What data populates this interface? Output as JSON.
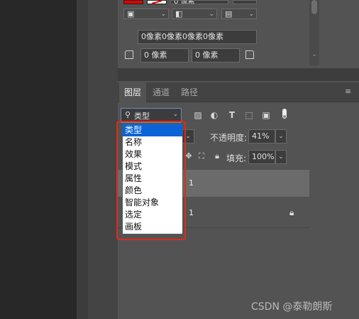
{
  "app": {
    "colors": {
      "accent_selected": "#0a64d8",
      "highlight_frame": "#e02a1a",
      "panel_bg": "#535353",
      "foreground_swatch": "#e00000"
    }
  },
  "top_options": {
    "stroke_width_value": "0 像素",
    "spacing_value": "0像素0像素0像素0像素",
    "width_value": "0 像素",
    "height_value": "0 像素",
    "icons": [
      "align-icon",
      "path-ops-icon",
      "arrange-icon",
      "corner-icon",
      "corner-icon-2"
    ]
  },
  "layers_panel": {
    "tabs": [
      {
        "label": "图层",
        "active": true
      },
      {
        "label": "通道",
        "active": false
      },
      {
        "label": "路径",
        "active": false
      }
    ],
    "filter": {
      "selected": "类型",
      "options": [
        "类型",
        "名称",
        "效果",
        "模式",
        "属性",
        "颜色",
        "智能对象",
        "选定",
        "画板"
      ]
    },
    "opacity_label": "不透明度:",
    "opacity_value": "41%",
    "fill_label": "填充:",
    "fill_value": "100%",
    "layers": [
      {
        "name": "1",
        "locked": false,
        "selected": true
      },
      {
        "name": "1",
        "locked": true,
        "selected": false
      }
    ]
  },
  "watermark": "CSDN @泰勒朗斯"
}
